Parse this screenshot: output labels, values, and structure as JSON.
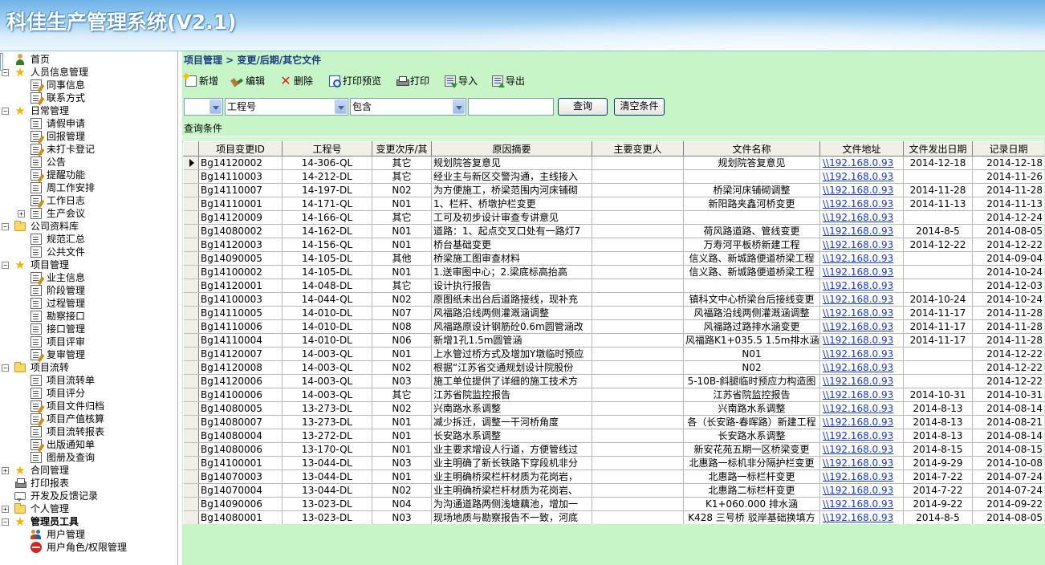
{
  "app": {
    "title": "科佳生产管理系统(V2.1)"
  },
  "sidebar": {
    "home": "首页",
    "personnel": {
      "label": "人员信息管理",
      "items": [
        "同事信息",
        "联系方式"
      ]
    },
    "daily": {
      "label": "日常管理",
      "items": [
        "请假申请",
        "回报管理",
        "未打卡登记",
        "公告",
        "提醒功能",
        "周工作安排",
        "工作日志"
      ],
      "meeting": "生产会议"
    },
    "company": {
      "label": "公司资料库",
      "items": [
        "规范汇总",
        "公共文件"
      ]
    },
    "project": {
      "label": "项目管理",
      "items": [
        "业主信息",
        "阶段管理",
        "过程管理",
        "勘察接口",
        "接口管理",
        "项目评审",
        "复审管理",
        "变更/后期/其它文件"
      ]
    },
    "flow": {
      "label": "项目流转",
      "items": [
        "项目流转单",
        "项目评分",
        "项目文件归档",
        "项目产值核算",
        "项目流转报表",
        "出版通知单",
        "图册及查询"
      ]
    },
    "contract": "合同管理",
    "print_report": "打印报表",
    "dev_feedback": "开发及反馈记录",
    "personal": "个人管理",
    "admin": {
      "label": "管理员工具",
      "items": [
        "用户管理",
        "用户角色/权限管理"
      ]
    }
  },
  "main": {
    "breadcrumb": "项目管理 > 变更/后期/其它文件",
    "toolbar": {
      "new": "新增",
      "edit": "编辑",
      "delete": "删除",
      "print_preview": "打印预览",
      "print": "打印",
      "import": "导入",
      "export": "导出"
    },
    "filter": {
      "field": "工程号",
      "operator": "包含",
      "query_btn": "查询",
      "clear_btn": "清空条件"
    },
    "query_label": "查询条件",
    "columns": [
      "项目变更ID",
      "工程号",
      "变更次序/其",
      "原因摘要",
      "主要变更人",
      "文件名称",
      "文件地址",
      "文件发出日期",
      "记录日期"
    ],
    "rows": [
      [
        "Bg14120002",
        "14-306-QL",
        "其它",
        "规划院答复意见",
        "",
        "规划院答复意见",
        "\\\\192.168.0.93",
        "2014-12-18",
        "2014-12-18"
      ],
      [
        "Bg14110003",
        "14-212-DL",
        "其它",
        "经业主与新区交警沟通，主线接入",
        "",
        "",
        "\\\\192.168.0.93",
        "",
        "2014-11-26"
      ],
      [
        "Bg14110007",
        "14-197-DL",
        "N02",
        "为方便施工，桥梁范围内河床铺砌",
        "",
        "桥梁河床铺砌调整",
        "\\\\192.168.0.93",
        "2014-11-28",
        "2014-11-28"
      ],
      [
        "Bg14110001",
        "14-171-QL",
        "N01",
        "1、栏杆、桥墩护栏变更",
        "",
        "新阳路夹鑫河桥变更",
        "\\\\192.168.0.93",
        "2014-11-13",
        "2014-11-13"
      ],
      [
        "Bg14120009",
        "14-166-QL",
        "其它",
        "工可及初步设计审查专讲意见",
        "",
        "",
        "\\\\192.168.0.93",
        "",
        "2014-12-24"
      ],
      [
        "Bg14080002",
        "14-162-DL",
        "N01",
        "道路：1、起点交叉口处有一路灯7",
        "",
        "荷风路道路、管线变更",
        "\\\\192.168.0.93",
        "2014-8-5",
        "2014-08-05"
      ],
      [
        "Bg14120003",
        "14-156-QL",
        "N01",
        "桥台基础变更",
        "",
        "万寿河平板桥新建工程",
        "\\\\192.168.0.93",
        "2014-12-22",
        "2014-12-22"
      ],
      [
        "Bg14090005",
        "14-105-DL",
        "其他",
        "桥梁施工图审查材料",
        "",
        "信义路、新城路便道桥梁工程",
        "\\\\192.168.0.93",
        "",
        "2014-09-04"
      ],
      [
        "Bg14100002",
        "14-105-DL",
        "N01",
        "1.送审图中心；2.梁底标高抬高",
        "",
        "信义路、新城路便道桥梁工程",
        "\\\\192.168.0.93",
        "",
        "2014-10-24"
      ],
      [
        "Bg14120001",
        "14-048-DL",
        "其它",
        "设计执行报告",
        "",
        "",
        "\\\\192.168.0.93",
        "",
        "2014-12-03"
      ],
      [
        "Bg14100003",
        "14-044-QL",
        "N02",
        "原图纸未出台后道路接线，现补充",
        "",
        "镇科文中心桥梁台后接线变更",
        "\\\\192.168.0.93",
        "2014-10-24",
        "2014-10-24"
      ],
      [
        "Bg14110005",
        "14-010-DL",
        "N07",
        "风福路沿线两侧灌溉涵调整",
        "",
        "风福路沿线两侧灌溉涵调整",
        "\\\\192.168.0.93",
        "2014-11-17",
        "2014-11-28"
      ],
      [
        "Bg14110006",
        "14-010-DL",
        "N08",
        "风福路原设计钢筋砼0.6m圆管涵改",
        "",
        "风福路过路排水涵变更",
        "\\\\192.168.0.93",
        "2014-11-17",
        "2014-11-28"
      ],
      [
        "Bg14110004",
        "14-010-DL",
        "N06",
        "新增1孔1.5m圆管涵",
        "",
        "风福路K1+035.5 1.5m排水涵",
        "\\\\192.168.0.93",
        "2014-11-17",
        "2014-11-28"
      ],
      [
        "Bg14120007",
        "14-003-QL",
        "N01",
        "上水管过桥方式及增加Y墩临时预应",
        "",
        "N01",
        "\\\\192.168.0.93",
        "",
        "2014-12-22"
      ],
      [
        "Bg14120008",
        "14-003-QL",
        "N02",
        "根据“江苏省交通规划设计院股份",
        "",
        "N02",
        "\\\\192.168.0.93",
        "",
        "2014-12-22"
      ],
      [
        "Bg14120006",
        "14-003-QL",
        "N03",
        "施工单位提供了详细的施工技术方",
        "",
        "5-10B-斜腿临时预应力构造图",
        "\\\\192.168.0.93",
        "",
        "2014-12-22"
      ],
      [
        "Bg14100006",
        "14-003-QL",
        "其它",
        "江苏省院监控报告",
        "",
        "江苏省院监控报告",
        "\\\\192.168.0.93",
        "2014-10-31",
        "2014-10-31"
      ],
      [
        "Bg14080005",
        "13-273-DL",
        "N02",
        "兴南路水系调整",
        "",
        "兴南路水系调整",
        "\\\\192.168.0.93",
        "2014-8-13",
        "2014-08-14"
      ],
      [
        "Bg14080007",
        "13-273-DL",
        "N01",
        "减少拆迁，调整一干河桥角度",
        "",
        "各（长安路-春晖路）新建工程",
        "\\\\192.168.0.93",
        "2014-8-13",
        "2014-08-21"
      ],
      [
        "Bg14080004",
        "13-272-DL",
        "N01",
        "长安路水系调整",
        "",
        "长安路水系调整",
        "\\\\192.168.0.93",
        "2014-8-13",
        "2014-08-14"
      ],
      [
        "Bg14080006",
        "13-170-QL",
        "N01",
        "业主要求增设人行道，方便管线过",
        "",
        "新安花苑五期一区桥梁变更",
        "\\\\192.168.0.93",
        "2014-8-15",
        "2014-08-15"
      ],
      [
        "Bg14100001",
        "13-044-DL",
        "N03",
        "业主明确了新长铁路下穿段机非分",
        "",
        "北惠路一标机非分隔护栏变更",
        "\\\\192.168.0.93",
        "2014-9-29",
        "2014-10-08"
      ],
      [
        "Bg14070003",
        "13-044-DL",
        "N01",
        "业主明确桥梁栏杆材质为花岗岩，",
        "",
        "北惠路一标栏杆变更",
        "\\\\192.168.0.93",
        "2014-7-22",
        "2014-07-24"
      ],
      [
        "Bg14070004",
        "13-044-DL",
        "N02",
        "业主明确桥梁栏杆材质为花岗岩、",
        "",
        "北惠路二标栏杆变更",
        "\\\\192.168.0.93",
        "2014-7-22",
        "2014-07-24"
      ],
      [
        "Bg14090006",
        "13-023-DL",
        "N04",
        "为沟通道路两侧浅塘藕池，增加一",
        "",
        "K1+060.000 排水涵",
        "\\\\192.168.0.93",
        "2014-9-22",
        "2014-09-22"
      ],
      [
        "Bg14080001",
        "13-023-DL",
        "N03",
        "现场地质与勘察报告不一致，河底",
        "",
        "K428 三号桥 驳岸基础换填方",
        "\\\\192.168.0.93",
        "2014-8-5",
        "2014-08-05"
      ]
    ]
  }
}
